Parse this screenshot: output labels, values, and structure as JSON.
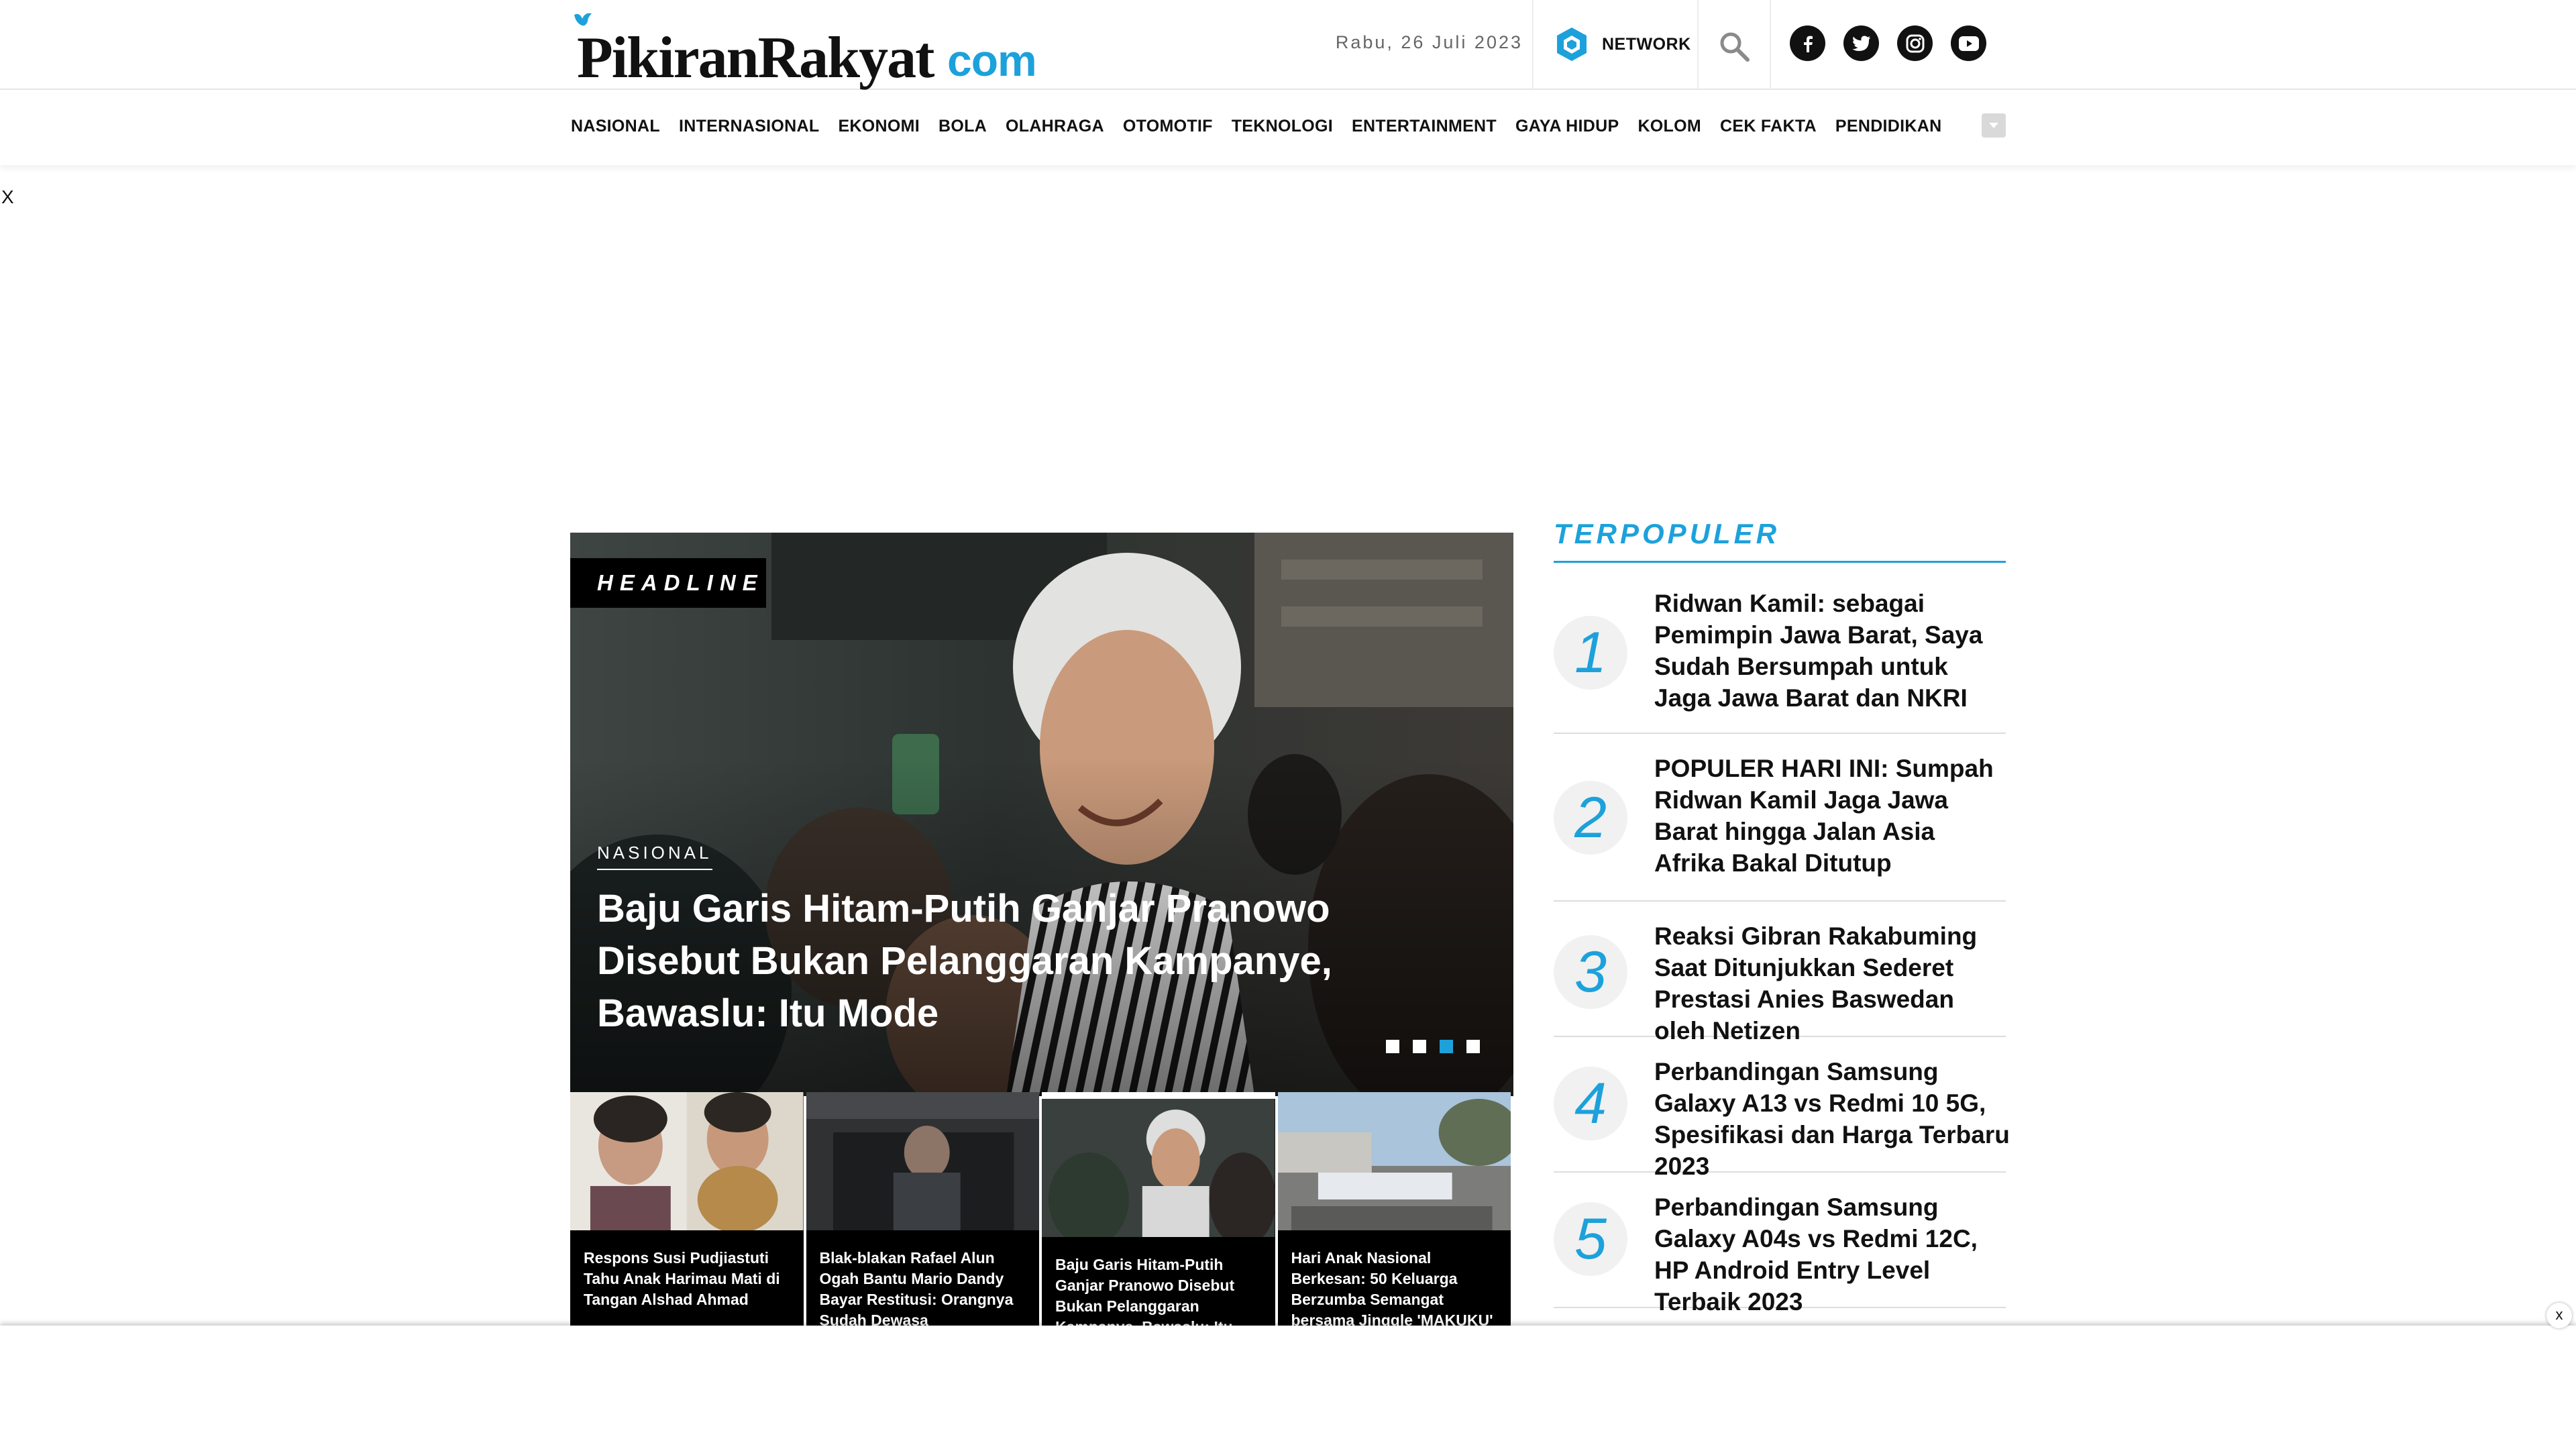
{
  "site": {
    "logo_text": "PikiranRakyat",
    "logo_suffix": "com",
    "date": "Rabu, 26 Juli 2023",
    "network_label": "NETWORK",
    "socials": [
      "facebook-icon",
      "twitter-icon",
      "instagram-icon",
      "youtube-icon"
    ]
  },
  "nav": {
    "items": [
      "NASIONAL",
      "INTERNASIONAL",
      "EKONOMI",
      "BOLA",
      "OLAHRAGA",
      "OTOMOTIF",
      "TEKNOLOGI",
      "ENTERTAINMENT",
      "GAYA HIDUP",
      "KOLOM",
      "CEK FAKTA",
      "PENDIDIKAN"
    ]
  },
  "ads": {
    "top_close": "X",
    "bottom_close": "x"
  },
  "headline": {
    "tag": "HEADLINE",
    "category": "NASIONAL",
    "title": "Baju Garis Hitam-Putih Ganjar Pranowo Disebut Bukan Pelanggaran Kampanye, Bawaslu: Itu Mode",
    "slides": 4,
    "active_slide": 3
  },
  "thumbs": [
    {
      "title": "Respons Susi Pudjiastuti Tahu Anak Harimau Mati di Tangan Alshad Ahmad"
    },
    {
      "title": "Blak-blakan Rafael Alun Ogah Bantu Mario Dandy Bayar Restitusi: Orangnya Sudah Dewasa"
    },
    {
      "title": "Baju Garis Hitam-Putih Ganjar Pranowo Disebut Bukan Pelanggaran Kampanye, Bawaslu: Itu Mode"
    },
    {
      "title": "Hari Anak Nasional Berkesan: 50 Keluarga Berzumba Semangat bersama Jinggle 'MAKUKU'"
    }
  ],
  "popular": {
    "heading": "TERPOPULER",
    "items": [
      {
        "num": "1",
        "title": "Ridwan Kamil: sebagai Pemimpin Jawa Barat, Saya Sudah Bersumpah untuk Jaga Jawa Barat dan NKRI"
      },
      {
        "num": "2",
        "title": "POPULER HARI INI: Sumpah Ridwan Kamil Jaga Jawa Barat hingga Jalan Asia Afrika Bakal Ditutup"
      },
      {
        "num": "3",
        "title": "Reaksi Gibran Rakabuming Saat Ditunjukkan Sederet Prestasi Anies Baswedan oleh Netizen"
      },
      {
        "num": "4",
        "title": "Perbandingan Samsung Galaxy A13 vs Redmi 10 5G, Spesifikasi dan Harga Terbaru 2023"
      },
      {
        "num": "5",
        "title": "Perbandingan Samsung Galaxy A04s vs Redmi 12C, HP Android Entry Level Terbaik 2023"
      }
    ]
  },
  "colors": {
    "accent": "#1da1db",
    "text": "#111111",
    "muted": "#666666"
  }
}
